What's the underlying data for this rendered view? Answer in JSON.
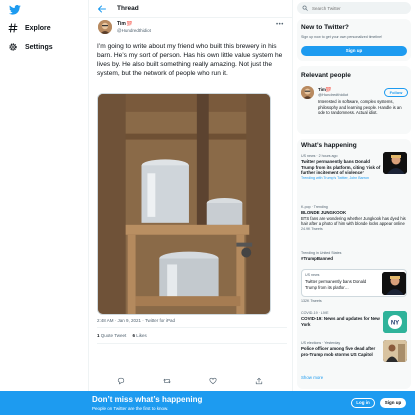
{
  "nav": {
    "items": [
      {
        "label": "Explore",
        "icon": "hashtag-icon"
      },
      {
        "label": "Settings",
        "icon": "gear-icon"
      }
    ]
  },
  "thread": {
    "header_title": "Thread",
    "author_name": "Tim",
    "author_hearts": "💯",
    "author_handle": "@Hundredthidiot",
    "text": "I’m going to write about my friend who built this brewery in his barn. He’s my sort of person. Has his own little value system he lives by. He also built something really amazing. Not just the system, but the network of people who run it.",
    "timestamp": "2:48 AM · Jan 9, 2021",
    "source": "Twitter for iPad",
    "quote_tweets_count": "1",
    "quote_tweets_label": "Quote Tweet",
    "likes_count": "6",
    "likes_label": "Likes"
  },
  "search": {
    "placeholder": "Search Twitter"
  },
  "new_to_twitter": {
    "title": "New to Twitter?",
    "subtitle": "Sign up now to get your own personalized timeline!",
    "button": "Sign up"
  },
  "relevant": {
    "title": "Relevant people",
    "name": "Tim",
    "hearts": "💯",
    "handle": "@Hundredthidiot",
    "follow": "Follow",
    "bio": "Interested in software, complex systems, philosophy and learning people. Handle is an ode to randomness. Actual idiot."
  },
  "happening": {
    "title": "What’s happening",
    "show_more": "Show more",
    "trends": [
      {
        "context": "US news · 2 hours ago",
        "title": "Twitter permanently bans Donald Trump from its platform, citing ‘risk of further incitement of violence’",
        "foot": "Trending with Trump’s Twitter, John Barron"
      },
      {
        "context": "K-pop · Trending",
        "title": "BLONDE JUNGKOOK",
        "desc": "BTS fans are wondering whether Jungkook has dyed his hair after a photo of him with blonde locks appear online",
        "foot": "24.9K Tweets"
      },
      {
        "context": "Trending in United States",
        "title": "#TrumpBanned",
        "quote_source": "US news",
        "quote_text": "Twitter permanently bans Donald Trump from its platfor…",
        "foot": "132K Tweets"
      },
      {
        "context": "COVID-19 · LIVE",
        "title": "COVID-19: News and updates for New York",
        "badge": "NY"
      },
      {
        "context": "US elections · Yesterday",
        "title": "Police officer among five dead after pro-Trump mob storms US Capitol"
      }
    ]
  },
  "bottom_bar": {
    "title": "Don’t miss what’s happening",
    "subtitle": "People on Twitter are the first to know.",
    "login": "Log in",
    "signup": "Sign up"
  },
  "colors": {
    "accent": "#1d9bf0",
    "text": "#0f1419",
    "muted": "#536471",
    "panel_bg": "#f7f9f9"
  }
}
